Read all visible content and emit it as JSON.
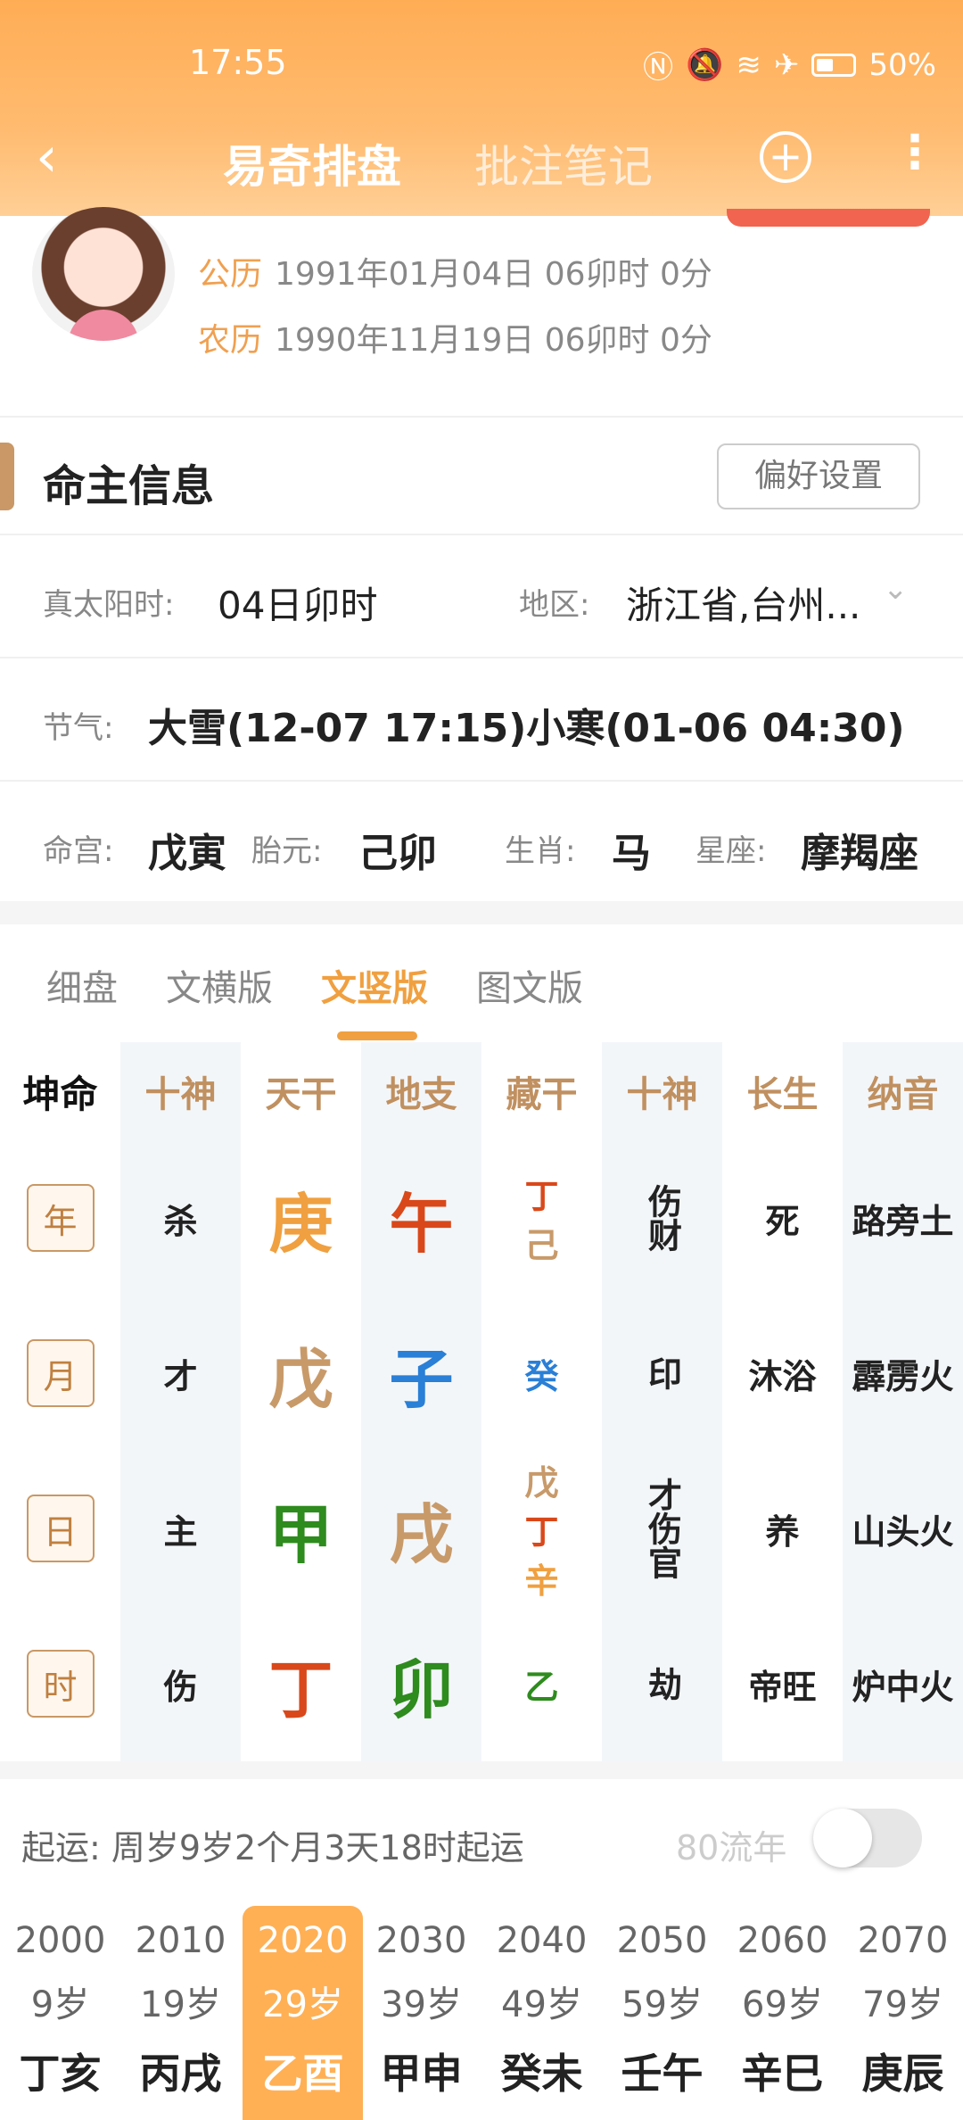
{
  "status_bar": {
    "time": "17:55",
    "battery": "50%",
    "icons": [
      "nfc-icon",
      "mute-icon",
      "wifi-icon",
      "airplane-icon",
      "battery-icon"
    ]
  },
  "nav": {
    "back": "‹",
    "tab_active": "易奇排盘",
    "tab_inactive": "批注笔记",
    "add": "+",
    "more": "⋮"
  },
  "profile": {
    "gongli_label": "公历",
    "gongli_value": "1991年01月04日 06卯时 0分",
    "nongli_label": "农历",
    "nongli_value": "1990年11月19日 06卯时 0分"
  },
  "mingzhu": {
    "title": "命主信息",
    "pref_button": "偏好设置"
  },
  "info": {
    "zty_label": "真太阳时:",
    "zty_value": "04日卯时",
    "region_label": "地区:",
    "region_value": "浙江省,台州...",
    "jieqi_label": "节气:",
    "jieqi_value": "大雪(12-07 17:15)小寒(01-06 04:30)",
    "minggong_label": "命宫:",
    "minggong_value": "戊寅",
    "taiyuan_label": "胎元:",
    "taiyuan_value": "己卯",
    "shengxiao_label": "生肖:",
    "shengxiao_value": "马",
    "xingzuo_label": "星座:",
    "xingzuo_value": "摩羯座"
  },
  "view_tabs": [
    "细盘",
    "文横版",
    "文竖版",
    "图文版"
  ],
  "chart": {
    "kunming": "坤命",
    "headers": [
      "十神",
      "天干",
      "地支",
      "藏干",
      "十神",
      "长生",
      "纳音"
    ],
    "rows": [
      {
        "pillar": "年",
        "shishen": "杀",
        "tiangan": "庚",
        "dizhi": "午",
        "canggan": [
          "丁",
          "己"
        ],
        "shishen2": "伤财",
        "changsheng": "死",
        "nayin": "路旁土"
      },
      {
        "pillar": "月",
        "shishen": "才",
        "tiangan": "戊",
        "dizhi": "子",
        "canggan": [
          "癸"
        ],
        "shishen2": "印",
        "changsheng": "沐浴",
        "nayin": "霹雳火"
      },
      {
        "pillar": "日",
        "shishen": "主",
        "tiangan": "甲",
        "dizhi": "戌",
        "canggan": [
          "戊",
          "丁",
          "辛"
        ],
        "shishen2": "才伤官",
        "changsheng": "养",
        "nayin": "山头火"
      },
      {
        "pillar": "时",
        "shishen": "伤",
        "tiangan": "丁",
        "dizhi": "卯",
        "canggan": [
          "乙"
        ],
        "shishen2": "劫",
        "changsheng": "帝旺",
        "nayin": "炉中火"
      }
    ],
    "colors": {
      "fire": "#d9481a",
      "earth": "#c89a6a",
      "water": "#2a7fd6",
      "wood": "#2e8b1e",
      "metal": "#f0a040"
    }
  },
  "qiyun": {
    "text": "起运: 周岁9岁2个月3天18时起运",
    "liunian": "80流年"
  },
  "dayun": [
    {
      "year": "2000",
      "age": "9岁",
      "gz": "丁亥"
    },
    {
      "year": "2010",
      "age": "19岁",
      "gz": "丙戌"
    },
    {
      "year": "2020",
      "age": "29岁",
      "gz": "乙酉"
    },
    {
      "year": "2030",
      "age": "39岁",
      "gz": "甲申"
    },
    {
      "year": "2040",
      "age": "49岁",
      "gz": "癸未"
    },
    {
      "year": "2050",
      "age": "59岁",
      "gz": "壬午"
    },
    {
      "year": "2060",
      "age": "69岁",
      "gz": "辛巳"
    },
    {
      "year": "2070",
      "age": "79岁",
      "gz": "庚辰"
    }
  ]
}
